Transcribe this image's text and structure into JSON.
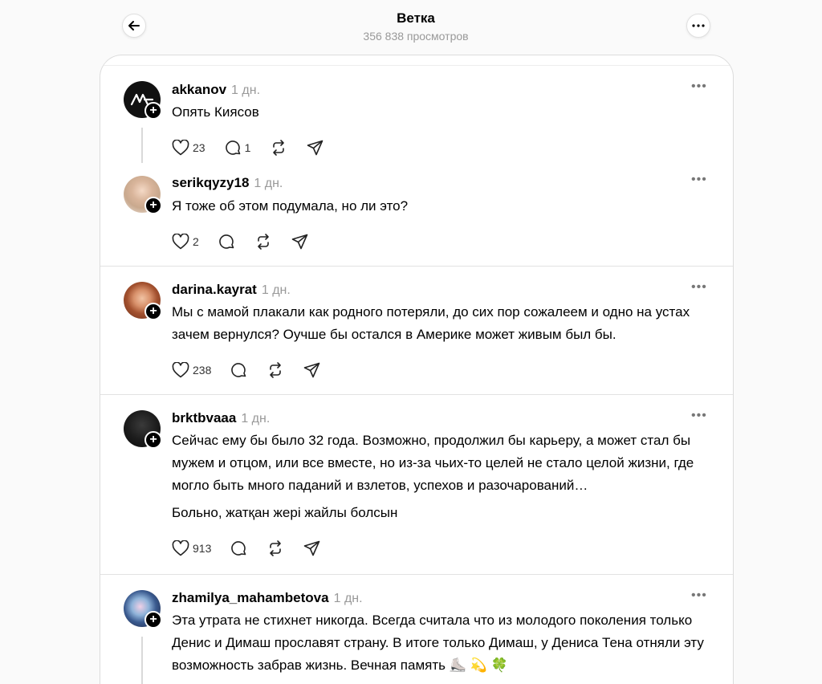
{
  "header": {
    "title": "Ветка",
    "subtitle": "356 838 просмотров",
    "back_icon": "arrow-left-icon",
    "more_icon": "more-horizontal-icon"
  },
  "colors": {
    "accent": "#000000",
    "muted": "#999999",
    "divider": "#e2e2e2"
  },
  "posts": [
    {
      "username": "akkanov",
      "time": "1 дн.",
      "text": "Опять Киясов",
      "likes": "23",
      "replies": "1",
      "avatar": "logo-avatar"
    },
    {
      "username": "serikqyzy18",
      "time": "1 дн.",
      "text": "Я тоже об этом подумала, но ли это?",
      "likes": "2",
      "replies": "",
      "avatar": "photo-avatar"
    },
    {
      "username": "darina.kayrat",
      "time": "1 дн.",
      "text": "Мы с мамой плакали как родного потеряли, до сих пор сожалеем и одно на устах зачем вернулся? Оучше бы остался в Америке может живым был бы.",
      "likes": "238",
      "replies": "",
      "avatar": "photo-avatar"
    },
    {
      "username": "brktbvaaa",
      "time": "1 дн.",
      "text": "Сейчас ему бы было 32 года. Возможно, продолжил бы карьеру, а может стал бы мужем и отцом, или все вместе, но из-за чьих-то целей не стало целой жизни, где могло быть много паданий и взлетов, успехов и разочарований…",
      "text2": "Больно, жатқан жері жайлы болсын",
      "likes": "913",
      "replies": "",
      "avatar": "photo-avatar"
    },
    {
      "username": "zhamilya_mahambetova",
      "time": "1 дн.",
      "text": "Эта утрата не стихнет никогда. Всегда считала что из молодого поколения только Денис и Димаш прославят страну. В итоге только Димаш, у Дениса Тена отняли эту возможность забрав жизнь. Вечная память ⛸️ 💫 🍀",
      "likes": "",
      "replies": "",
      "avatar": "photo-avatar"
    }
  ]
}
